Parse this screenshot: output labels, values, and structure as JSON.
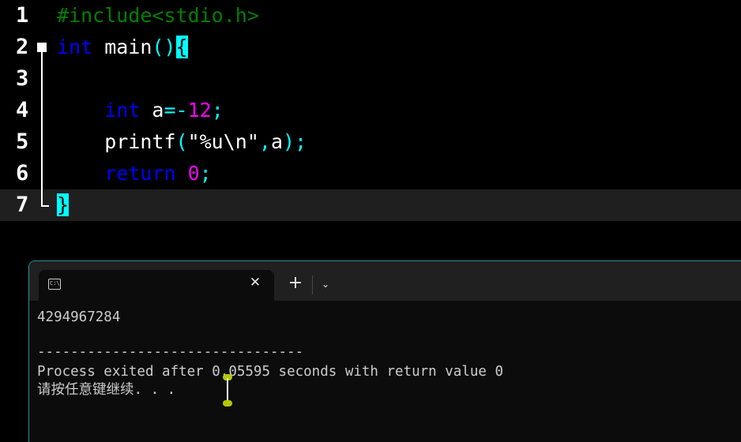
{
  "editor": {
    "lines": [
      {
        "num": "1",
        "tokens": [
          {
            "t": "#include<stdio.h>",
            "c": "pre"
          }
        ]
      },
      {
        "num": "2",
        "tokens": [
          {
            "t": "int",
            "c": "kw"
          },
          {
            "t": " main",
            "c": "plain"
          },
          {
            "t": "()",
            "c": "op"
          },
          {
            "t": "{",
            "c": "brace-hl"
          }
        ]
      },
      {
        "num": "3",
        "tokens": []
      },
      {
        "num": "4",
        "tokens": [
          {
            "t": "    ",
            "c": "plain"
          },
          {
            "t": "int",
            "c": "kw"
          },
          {
            "t": " a",
            "c": "plain"
          },
          {
            "t": "=-",
            "c": "op"
          },
          {
            "t": "12",
            "c": "num"
          },
          {
            "t": ";",
            "c": "op"
          }
        ]
      },
      {
        "num": "5",
        "tokens": [
          {
            "t": "    printf",
            "c": "plain"
          },
          {
            "t": "(",
            "c": "op"
          },
          {
            "t": "\"%u\\n\"",
            "c": "str"
          },
          {
            "t": ",",
            "c": "op"
          },
          {
            "t": "a",
            "c": "plain"
          },
          {
            "t": ");",
            "c": "op"
          }
        ]
      },
      {
        "num": "6",
        "tokens": [
          {
            "t": "    ",
            "c": "plain"
          },
          {
            "t": "return",
            "c": "kw"
          },
          {
            "t": " ",
            "c": "plain"
          },
          {
            "t": "0",
            "c": "num"
          },
          {
            "t": ";",
            "c": "op"
          }
        ]
      },
      {
        "num": "7",
        "tokens": [
          {
            "t": "}",
            "c": "brace-hl"
          }
        ]
      }
    ],
    "current_line": 7
  },
  "terminal": {
    "tab_icon_text": "C:\\",
    "close_glyph": "✕",
    "new_tab_glyph": "+",
    "dropdown_glyph": "⌄",
    "output": [
      "4294967284",
      "",
      "--------------------------------",
      "Process exited after 0.05595 seconds with return value 0",
      "请按任意键继续. . ."
    ]
  }
}
